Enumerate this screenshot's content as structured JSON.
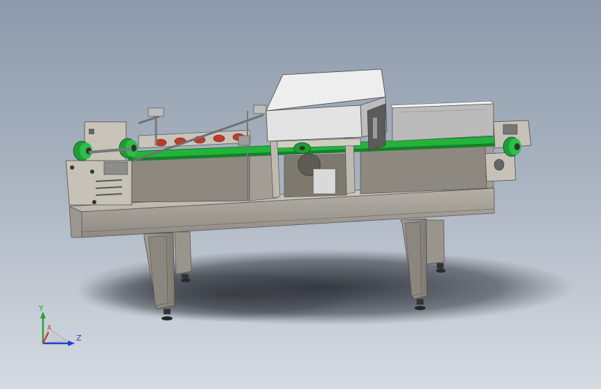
{
  "viewport": {
    "background_top": "#8d9aab",
    "background_bottom": "#d6dbe2"
  },
  "model": {
    "frame_color": "#a9a49b",
    "belt_color": "#22b43a",
    "roller_color": "#c0392b",
    "housing_color": "#e6e6e6"
  },
  "triad": {
    "y_label": "Y",
    "x_label": "X",
    "z_label": "Z",
    "y_color": "#2ca02c",
    "x_color": "#d62728",
    "z_color": "#1f3fcf"
  }
}
